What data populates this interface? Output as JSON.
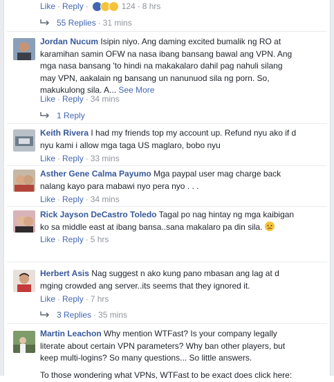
{
  "top_actions": {
    "like": "Like",
    "reply": "Reply",
    "reaction_count": "124",
    "time": "8 hrs"
  },
  "top_replies": {
    "label": "55 Replies",
    "time": "31 mins"
  },
  "comments": [
    {
      "name": "Jordan Nucum",
      "text": "Isipin niyo. Ang daming excited bumalik ng RO at karamihan samin OFW na nasa ibang bansang bawal ang VPN. Ang mga nasa bansang 'to hindi na makakalaro dahil pag nahuli silang may VPN, aakalain ng bansang un nanunuod sila ng porn. So, makukulong sila. A...",
      "see_more": "See More",
      "like": "Like",
      "reply": "Reply",
      "time": "34 mins",
      "replies": "1 Reply"
    },
    {
      "name": "Keith Rivera",
      "text": "I had my friends top my account up. Refund nyu ako if d nyu kami i allow mga taga US maglaro, bobo nyu",
      "like": "Like",
      "reply": "Reply",
      "time": "33 mins"
    },
    {
      "name": "Asther Gene Calma Payumo",
      "text": "Mga paypal user mag charge back nalang kayo para mabawi nyo pera nyo . . .",
      "like": "Like",
      "reply": "Reply",
      "time": "34 mins"
    },
    {
      "name": "Rick Jayson DeCastro Toledo",
      "text": "Tagal po nag hintay ng mga kaibigan ko sa middle east at ibang bansa..sana makalaro pa din sila.",
      "like": "Like",
      "reply": "Reply",
      "time": "5 hrs"
    },
    {
      "name": "Herbert Asis",
      "text": "Nag suggest n ako kung pano mbasan ang lag at d mging crowded ang server..its seems that they ignored it.",
      "like": "Like",
      "reply": "Reply",
      "time": "7 hrs",
      "replies": "3 Replies",
      "replies_time": "35 mins"
    },
    {
      "name": "Martin Leachon",
      "text": "Why mention WTFast? Is your company legally literate about certain VPN parameters? Why ban other players, but keep multi-logins? So many questions... So little answers.",
      "text2": "To those wondering what VPNs, WTFast to be exact does click here:"
    }
  ],
  "colors": {
    "link": "#4267b2",
    "name": "#365899",
    "meta": "#90949c",
    "text": "#1d2129"
  }
}
